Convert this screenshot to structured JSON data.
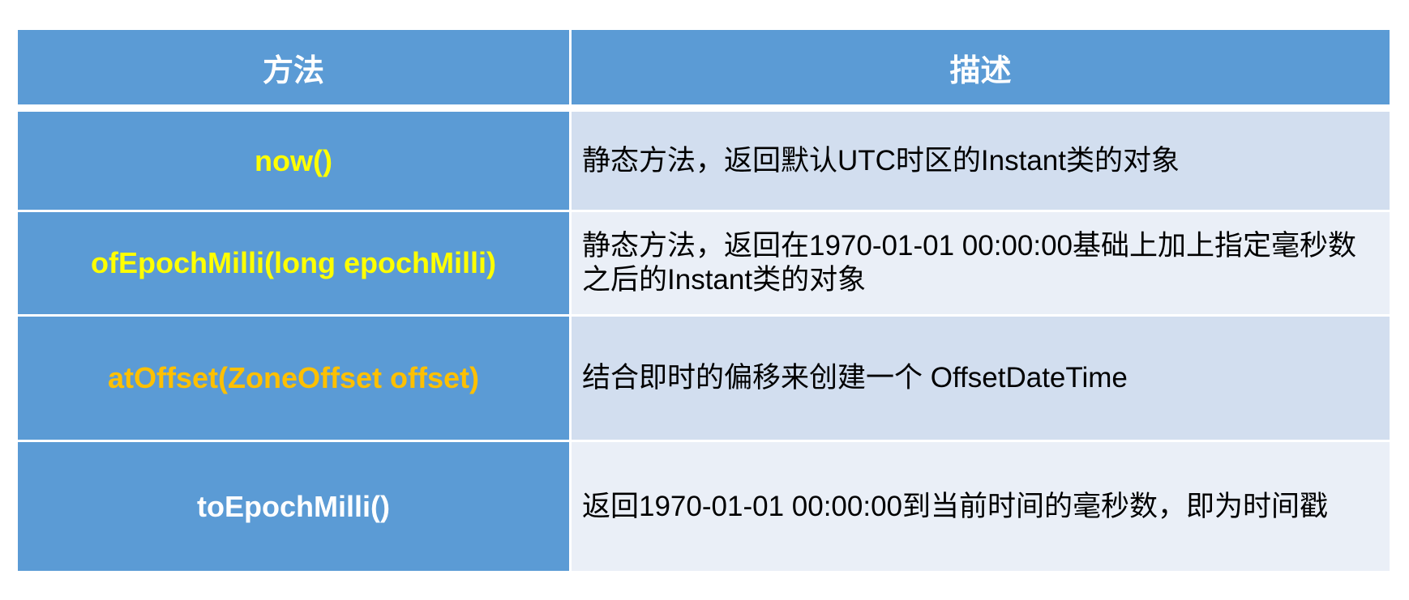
{
  "header": {
    "method": "方法",
    "description": "描述"
  },
  "rows": [
    {
      "method": "now()",
      "method_color": "#ffff00",
      "description": "静态方法，返回默认UTC时区的Instant类的对象"
    },
    {
      "method": "ofEpochMilli(long epochMilli)",
      "method_color": "#ffff00",
      "description": "静态方法，返回在1970-01-01 00:00:00基础上加上指定毫秒数之后的Instant类的对象"
    },
    {
      "method": "atOffset(ZoneOffset offset)",
      "method_color": "#ffc000",
      "description": "结合即时的偏移来创建一个 OffsetDateTime"
    },
    {
      "method": "toEpochMilli()",
      "method_color": "#ffffff",
      "description": "返回1970-01-01 00:00:00到当前时间的毫秒数，即为时间戳"
    }
  ],
  "colors": {
    "header_bg": "#5b9bd5",
    "row_odd_bg": "#d2deef",
    "row_even_bg": "#eaeff7"
  }
}
